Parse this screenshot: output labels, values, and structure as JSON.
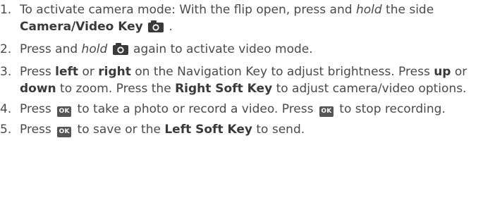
{
  "icons": {
    "camera_key": "camera-icon",
    "ok_key": "ok-key-icon"
  },
  "colors": {
    "text": "#4a4a4a",
    "key_bg": "#555555"
  },
  "ok_label": "OK",
  "steps": [
    {
      "num": "1.",
      "t1": "To activate camera mode: With the flip open, press and ",
      "t2": "hold",
      "t3": " the side ",
      "t4": "Camera/Video Key",
      "t5": " ."
    },
    {
      "num": "2.",
      "t1": "Press and ",
      "t2": "hold",
      "t3": " again to activate video mode."
    },
    {
      "num": "3.",
      "t1": "Press ",
      "t2": "left",
      "t3": " or ",
      "t4": "right",
      "t5": " on the Navigation Key to adjust brightness. Press ",
      "t6": "up",
      "t7": " or ",
      "t8": "down",
      "t9": " to zoom. Press the ",
      "t10": "Right Soft Key",
      "t11": " to adjust camera/video options."
    },
    {
      "num": "4.",
      "t1": "Press ",
      "t2": " to take a photo or record a video. Press ",
      "t3": " to stop recording."
    },
    {
      "num": "5.",
      "t1": "Press ",
      "t2": " to save or the ",
      "t3": "Left Soft Key",
      "t4": " to send."
    }
  ]
}
